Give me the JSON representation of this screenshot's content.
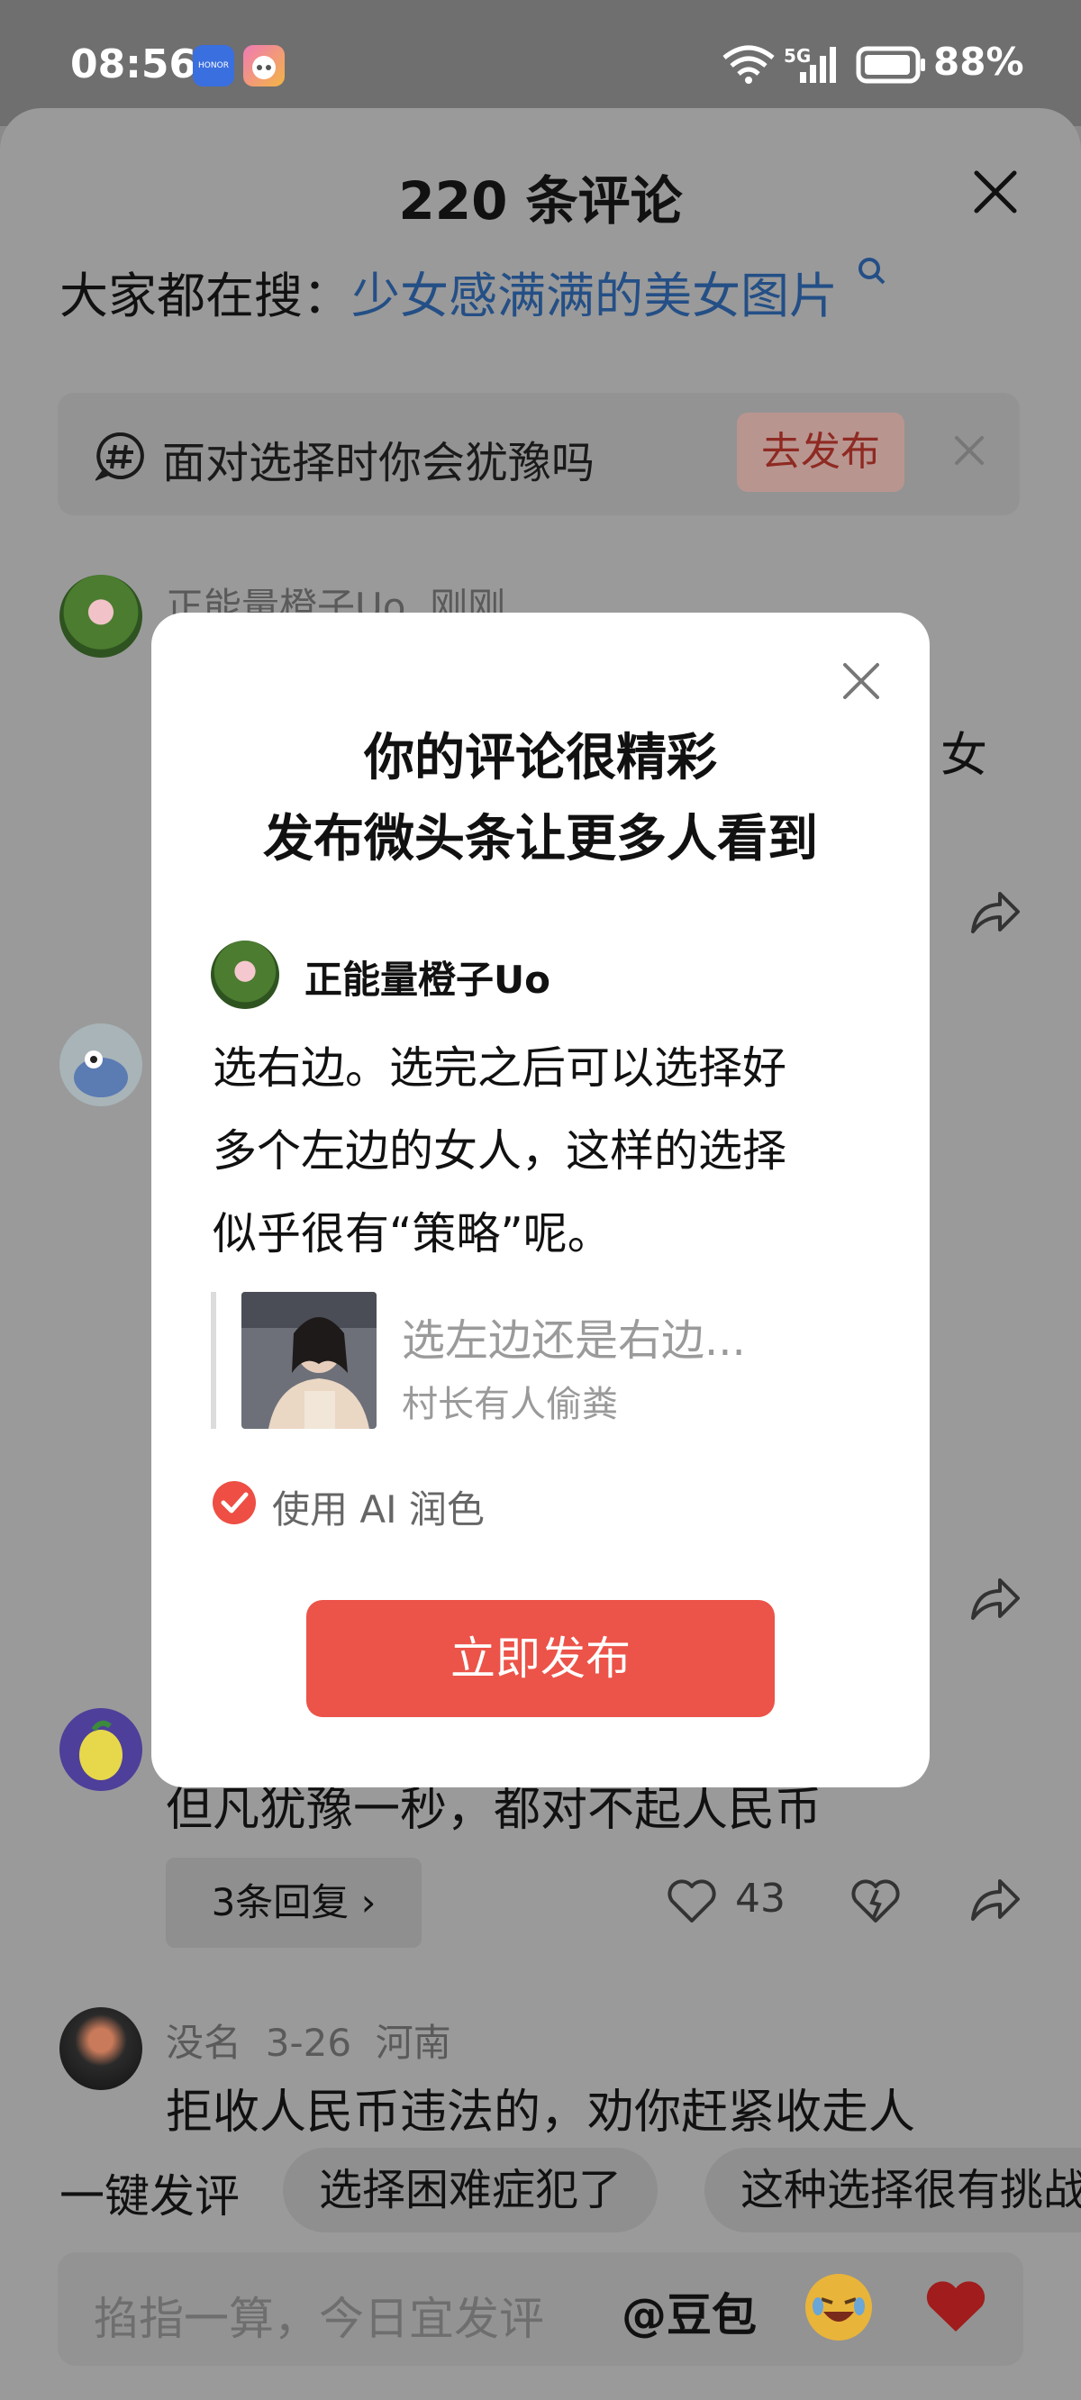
{
  "status_bar": {
    "time": "08:56",
    "app_badge_1": "HONOR",
    "network": "5G",
    "battery": "88%"
  },
  "sheet": {
    "title": "220 条评论",
    "trending_label": "大家都在搜：",
    "trending_query": "少女感满满的美女图片",
    "topic": {
      "text": "面对选择时你会犹豫吗",
      "button": "去发布"
    },
    "comments": [
      {
        "user": "正能量橙子Uo",
        "time": "刚刚",
        "text_fragment": "女"
      },
      {
        "text": "但凡犹豫一秒，都对不起人民币",
        "reply_button": "3条回复 ›",
        "likes": "43"
      },
      {
        "user": "没名",
        "date": "3-26",
        "location": "河南",
        "text": "拒收人民币违法的，劝你赶紧收走人"
      }
    ],
    "quick_comment": {
      "label": "一键发评",
      "chips": [
        "选择困难症犯了",
        "这种选择很有挑战"
      ]
    },
    "input": {
      "placeholder": "掐指一算，今日宜发评",
      "mention": "@豆包"
    }
  },
  "modal": {
    "title_line1": "你的评论很精彩",
    "title_line2": "发布微头条让更多人看到",
    "username": "正能量橙子Uo",
    "comment_line1": "选右边。选完之后可以选择好",
    "comment_line2": "多个左边的女人，这样的选择",
    "comment_line3": "似乎很有“策略”呢。",
    "quote_title": "选左边还是右边...",
    "quote_author": "村长有人偷粪",
    "ai_polish_label": "使用 AI 润色",
    "ai_polish_checked": true,
    "publish_button": "立即发布",
    "accent_color": "#ec5349"
  }
}
